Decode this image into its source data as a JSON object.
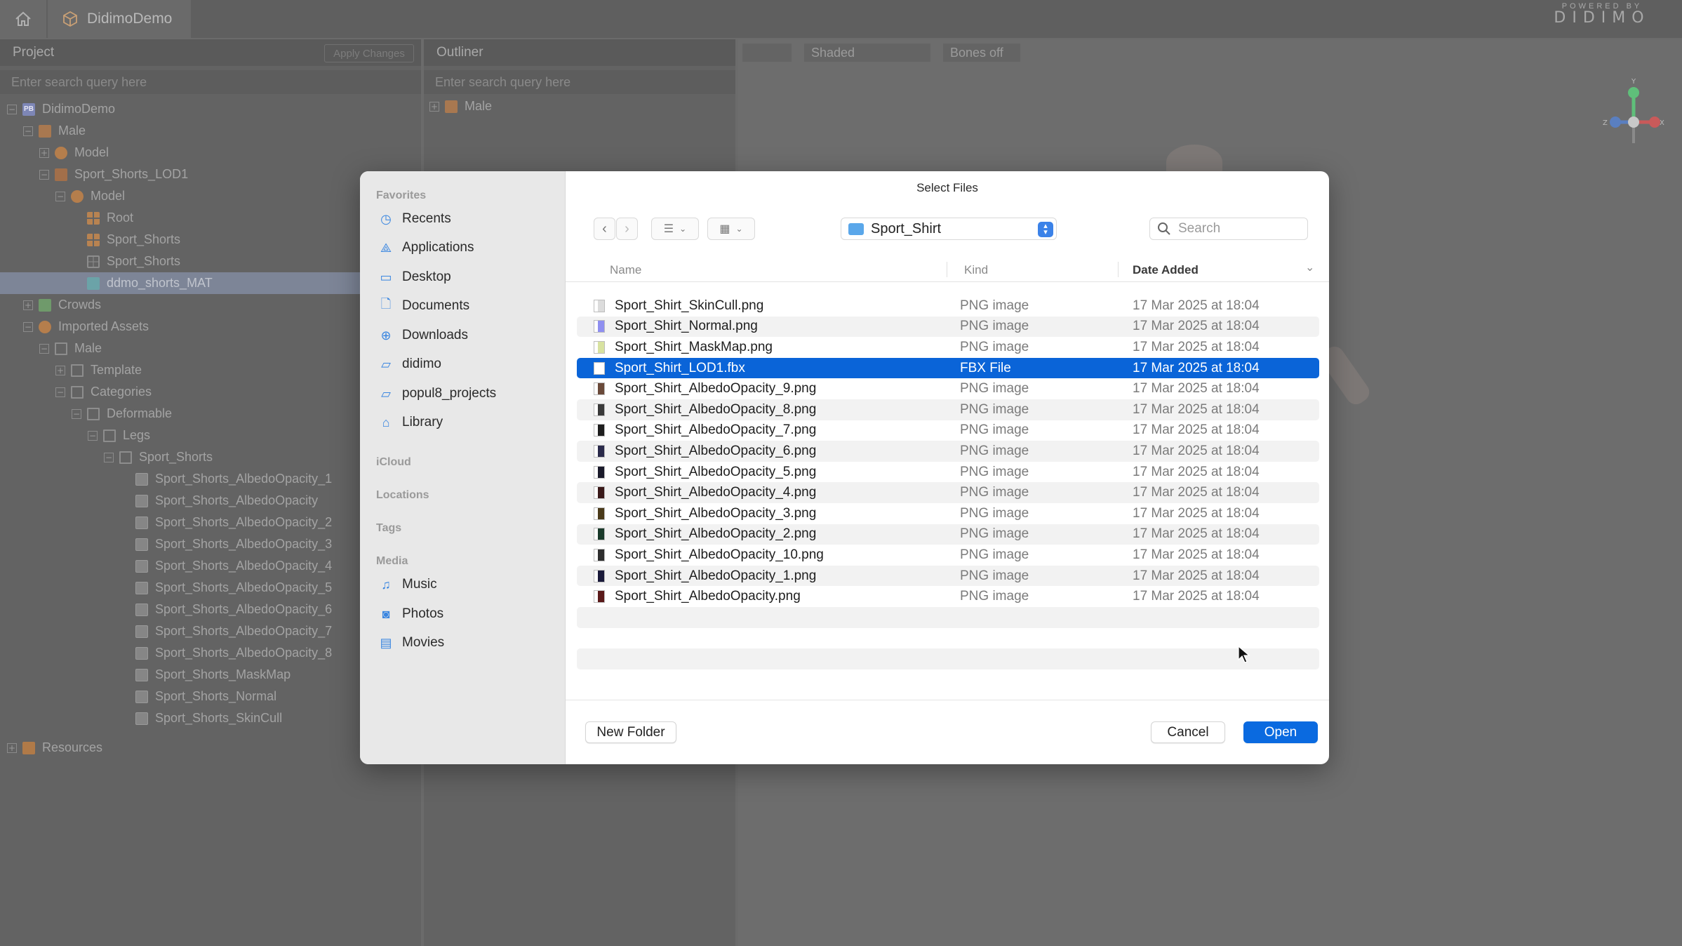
{
  "app": {
    "title": "DidimoDemo",
    "brand_top": "POWERED BY",
    "brand_logo": "DIDIMO"
  },
  "project": {
    "header": "Project",
    "apply_label": "Apply Changes",
    "search_placeholder": "Enter search query here",
    "tree": [
      {
        "label": "DidimoDemo",
        "depth": 0,
        "expander": "−",
        "icon": "pb"
      },
      {
        "label": "Male",
        "depth": 1,
        "expander": "−",
        "icon": "male"
      },
      {
        "label": "Model",
        "depth": 2,
        "expander": "+",
        "icon": "model"
      },
      {
        "label": "Sport_Shorts_LOD1",
        "depth": 2,
        "expander": "−",
        "icon": "obj"
      },
      {
        "label": "Model",
        "depth": 3,
        "expander": "−",
        "icon": "model"
      },
      {
        "label": "Root",
        "depth": 4,
        "expander": "",
        "icon": "grid"
      },
      {
        "label": "Sport_Shorts",
        "depth": 4,
        "expander": "",
        "icon": "grid"
      },
      {
        "label": "Sport_Shorts",
        "depth": 4,
        "expander": "",
        "icon": "grid2"
      },
      {
        "label": "ddmo_shorts_MAT",
        "depth": 4,
        "expander": "",
        "icon": "mat",
        "selected": true
      },
      {
        "label": "Crowds",
        "depth": 1,
        "expander": "+",
        "icon": "crowd"
      },
      {
        "label": "Imported Assets",
        "depth": 1,
        "expander": "−",
        "icon": "model"
      },
      {
        "label": "Male",
        "depth": 2,
        "expander": "−",
        "icon": "folder"
      },
      {
        "label": "Template",
        "depth": 3,
        "expander": "+",
        "icon": "folder"
      },
      {
        "label": "Categories",
        "depth": 3,
        "expander": "−",
        "icon": "folder"
      },
      {
        "label": "Deformable",
        "depth": 4,
        "expander": "−",
        "icon": "folder"
      },
      {
        "label": "Legs",
        "depth": 5,
        "expander": "−",
        "icon": "folder"
      },
      {
        "label": "Sport_Shorts",
        "depth": 6,
        "expander": "−",
        "icon": "folder"
      },
      {
        "label": "Sport_Shorts_AlbedoOpacity_1",
        "depth": 7,
        "expander": "",
        "icon": "tex"
      },
      {
        "label": "Sport_Shorts_AlbedoOpacity",
        "depth": 7,
        "expander": "",
        "icon": "tex"
      },
      {
        "label": "Sport_Shorts_AlbedoOpacity_2",
        "depth": 7,
        "expander": "",
        "icon": "tex"
      },
      {
        "label": "Sport_Shorts_AlbedoOpacity_3",
        "depth": 7,
        "expander": "",
        "icon": "tex"
      },
      {
        "label": "Sport_Shorts_AlbedoOpacity_4",
        "depth": 7,
        "expander": "",
        "icon": "tex"
      },
      {
        "label": "Sport_Shorts_AlbedoOpacity_5",
        "depth": 7,
        "expander": "",
        "icon": "tex"
      },
      {
        "label": "Sport_Shorts_AlbedoOpacity_6",
        "depth": 7,
        "expander": "",
        "icon": "tex"
      },
      {
        "label": "Sport_Shorts_AlbedoOpacity_7",
        "depth": 7,
        "expander": "",
        "icon": "tex"
      },
      {
        "label": "Sport_Shorts_AlbedoOpacity_8",
        "depth": 7,
        "expander": "",
        "icon": "tex"
      },
      {
        "label": "Sport_Shorts_MaskMap",
        "depth": 7,
        "expander": "",
        "icon": "tex"
      },
      {
        "label": "Sport_Shorts_Normal",
        "depth": 7,
        "expander": "",
        "icon": "tex"
      },
      {
        "label": "Sport_Shorts_SkinCull",
        "depth": 7,
        "expander": "",
        "icon": "tex"
      },
      {
        "label": "Resources",
        "depth": 0,
        "expander": "+",
        "icon": "res",
        "gap": true
      }
    ]
  },
  "outliner": {
    "header": "Outliner",
    "search_placeholder": "Enter search query here",
    "item": "Male"
  },
  "viewport": {
    "shading": "Shaded",
    "bones": "Bones off"
  },
  "dialog": {
    "title": "Select Files",
    "sidebar": {
      "favorites_title": "Favorites",
      "favorites": [
        "Recents",
        "Applications",
        "Desktop",
        "Documents",
        "Downloads",
        "didimo",
        "popul8_projects",
        "Library"
      ],
      "icloud_title": "iCloud",
      "locations_title": "Locations",
      "tags_title": "Tags",
      "media_title": "Media",
      "media": [
        "Music",
        "Photos",
        "Movies"
      ]
    },
    "path": "Sport_Shirt",
    "search_placeholder": "Search",
    "columns": {
      "name": "Name",
      "kind": "Kind",
      "date": "Date Added"
    },
    "files": [
      {
        "name": "Sport_Shirt_SkinCull.png",
        "kind": "PNG image",
        "date": "17 Mar 2025 at 18:04",
        "thumb": "#dcdcdc"
      },
      {
        "name": "Sport_Shirt_Normal.png",
        "kind": "PNG image",
        "date": "17 Mar 2025 at 18:04",
        "thumb": "#8f8ff0"
      },
      {
        "name": "Sport_Shirt_MaskMap.png",
        "kind": "PNG image",
        "date": "17 Mar 2025 at 18:04",
        "thumb": "#d8e2a0"
      },
      {
        "name": "Sport_Shirt_LOD1.fbx",
        "kind": "FBX File",
        "date": "17 Mar 2025 at 18:04",
        "thumb": "#ffffff",
        "selected": true
      },
      {
        "name": "Sport_Shirt_AlbedoOpacity_9.png",
        "kind": "PNG image",
        "date": "17 Mar 2025 at 18:04",
        "thumb": "#6a4a3a"
      },
      {
        "name": "Sport_Shirt_AlbedoOpacity_8.png",
        "kind": "PNG image",
        "date": "17 Mar 2025 at 18:04",
        "thumb": "#3a3a3a"
      },
      {
        "name": "Sport_Shirt_AlbedoOpacity_7.png",
        "kind": "PNG image",
        "date": "17 Mar 2025 at 18:04",
        "thumb": "#1e1e1e"
      },
      {
        "name": "Sport_Shirt_AlbedoOpacity_6.png",
        "kind": "PNG image",
        "date": "17 Mar 2025 at 18:04",
        "thumb": "#2a2a4a"
      },
      {
        "name": "Sport_Shirt_AlbedoOpacity_5.png",
        "kind": "PNG image",
        "date": "17 Mar 2025 at 18:04",
        "thumb": "#1a1a2a"
      },
      {
        "name": "Sport_Shirt_AlbedoOpacity_4.png",
        "kind": "PNG image",
        "date": "17 Mar 2025 at 18:04",
        "thumb": "#3a1a1a"
      },
      {
        "name": "Sport_Shirt_AlbedoOpacity_3.png",
        "kind": "PNG image",
        "date": "17 Mar 2025 at 18:04",
        "thumb": "#4a3a1a"
      },
      {
        "name": "Sport_Shirt_AlbedoOpacity_2.png",
        "kind": "PNG image",
        "date": "17 Mar 2025 at 18:04",
        "thumb": "#1a3a2a"
      },
      {
        "name": "Sport_Shirt_AlbedoOpacity_10.png",
        "kind": "PNG image",
        "date": "17 Mar 2025 at 18:04",
        "thumb": "#2e2e2e"
      },
      {
        "name": "Sport_Shirt_AlbedoOpacity_1.png",
        "kind": "PNG image",
        "date": "17 Mar 2025 at 18:04",
        "thumb": "#1a1a3a"
      },
      {
        "name": "Sport_Shirt_AlbedoOpacity.png",
        "kind": "PNG image",
        "date": "17 Mar 2025 at 18:04",
        "thumb": "#5a1a1a"
      }
    ],
    "new_folder": "New Folder",
    "cancel": "Cancel",
    "open": "Open"
  },
  "colors": {
    "accent": "#0a64d8",
    "tree_selection": "#7d8597"
  }
}
